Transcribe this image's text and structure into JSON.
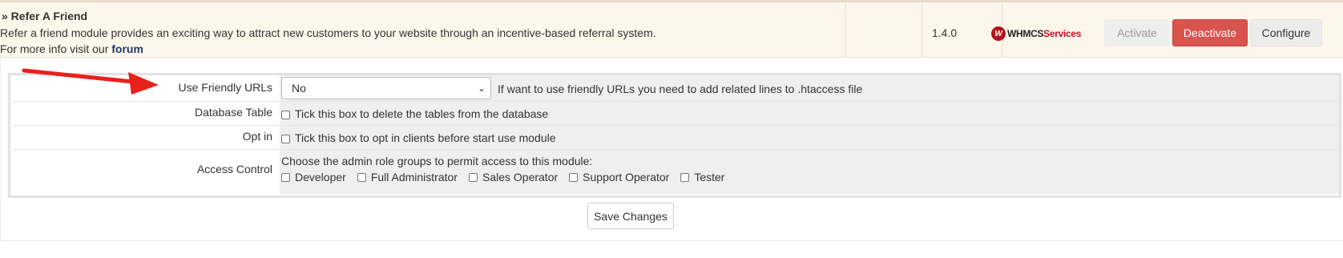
{
  "module": {
    "title": "» Refer A Friend",
    "description": "Refer a friend module provides an exciting way to attract new customers to your website through an incentive-based referral system.",
    "more_info_prefix": "For more info visit our ",
    "more_info_link": "forum",
    "version": "1.4.0",
    "logo": {
      "emblem": "W",
      "text_dark": "WHMCS",
      "text_red": "Services"
    },
    "buttons": {
      "activate": "Activate",
      "deactivate": "Deactivate",
      "configure": "Configure"
    }
  },
  "config": {
    "friendly_urls": {
      "label": "Use Friendly URLs",
      "value": "No",
      "hint": "If want to use friendly URLs you need to add related lines to .htaccess file"
    },
    "database_table": {
      "label": "Database Table",
      "checkbox_label": "Tick this box to delete the tables from the database"
    },
    "opt_in": {
      "label": "Opt in",
      "checkbox_label": "Tick this box to opt in clients before start use module"
    },
    "access_control": {
      "label": "Access Control",
      "instruction": "Choose the admin role groups to permit access to this module:",
      "roles": [
        "Developer",
        "Full Administrator",
        "Sales Operator",
        "Support Operator",
        "Tester"
      ]
    }
  },
  "save_label": "Save Changes",
  "colors": {
    "deactivate": "#d9534f",
    "arrow": "#e8211d",
    "row_bg": "#fdf6ea"
  }
}
